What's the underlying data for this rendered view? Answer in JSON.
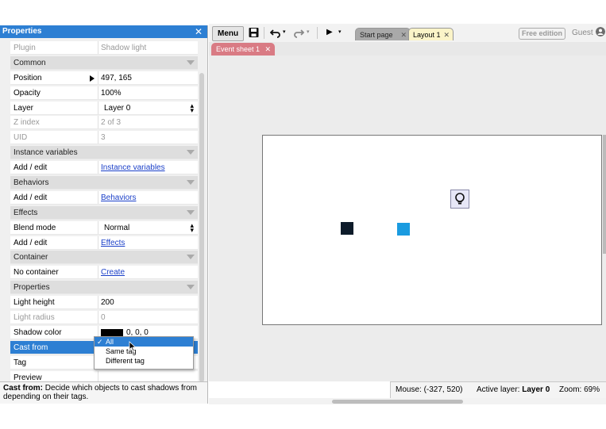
{
  "properties_panel": {
    "title": "Properties",
    "rows": [
      {
        "label": "Plugin",
        "value": "Shadow light",
        "kind": "disabled"
      },
      {
        "label": "Common",
        "kind": "header"
      },
      {
        "label": "Position",
        "value": "497, 165",
        "kind": "expand"
      },
      {
        "label": "Opacity",
        "value": "100%"
      },
      {
        "label": "Layer",
        "value": "Layer 0",
        "kind": "select"
      },
      {
        "label": "Z index",
        "value": "2 of 3",
        "kind": "disabled"
      },
      {
        "label": "UID",
        "value": "3",
        "kind": "disabled"
      },
      {
        "label": "Instance variables",
        "kind": "header"
      },
      {
        "label": "Add / edit",
        "value": "Instance variables",
        "kind": "link"
      },
      {
        "label": "Behaviors",
        "kind": "header"
      },
      {
        "label": "Add / edit",
        "value": "Behaviors",
        "kind": "link"
      },
      {
        "label": "Effects",
        "kind": "header"
      },
      {
        "label": "Blend mode",
        "value": "Normal",
        "kind": "select"
      },
      {
        "label": "Add / edit",
        "value": "Effects",
        "kind": "link"
      },
      {
        "label": "Container",
        "kind": "header"
      },
      {
        "label": "No container",
        "value": "Create",
        "kind": "link"
      },
      {
        "label": "Properties",
        "kind": "header"
      },
      {
        "label": "Light height",
        "value": "200"
      },
      {
        "label": "Light radius",
        "value": "0",
        "kind": "disabled"
      },
      {
        "label": "Shadow color",
        "value": "0, 0, 0",
        "kind": "color",
        "color": "#000000"
      },
      {
        "label": "Cast from",
        "value": "",
        "kind": "selected"
      },
      {
        "label": "Tag",
        "value": ""
      },
      {
        "label": "Preview",
        "value": ""
      }
    ],
    "dropdown_options": [
      "All",
      "Same tag",
      "Different tag"
    ],
    "dropdown_selected": "All",
    "description_label": "Cast from:",
    "description_text": " Decide which objects to cast shadows from depending on their tags."
  },
  "toolbar": {
    "menu_label": "Menu",
    "tabs": [
      {
        "label": "Start page",
        "close": "✕"
      },
      {
        "label": "Layout 1",
        "close": "✕"
      }
    ],
    "edition_label": "Free edition",
    "user_label": "Guest"
  },
  "editor_tabs": [
    {
      "label": "Event sheet 1",
      "close": "✕"
    }
  ],
  "status": {
    "mouse_label": "Mouse:",
    "mouse_value": "(-327, 520)",
    "layer_label": "Active layer:",
    "layer_value": "Layer 0",
    "zoom_label": "Zoom:",
    "zoom_value": "69%"
  },
  "colors": {
    "accent": "#2d7fd3",
    "event_tab": "#d97b84",
    "layout_tab": "#fbf4c8",
    "object_dark": "#0d1b2a",
    "object_blue": "#1a9be0"
  }
}
